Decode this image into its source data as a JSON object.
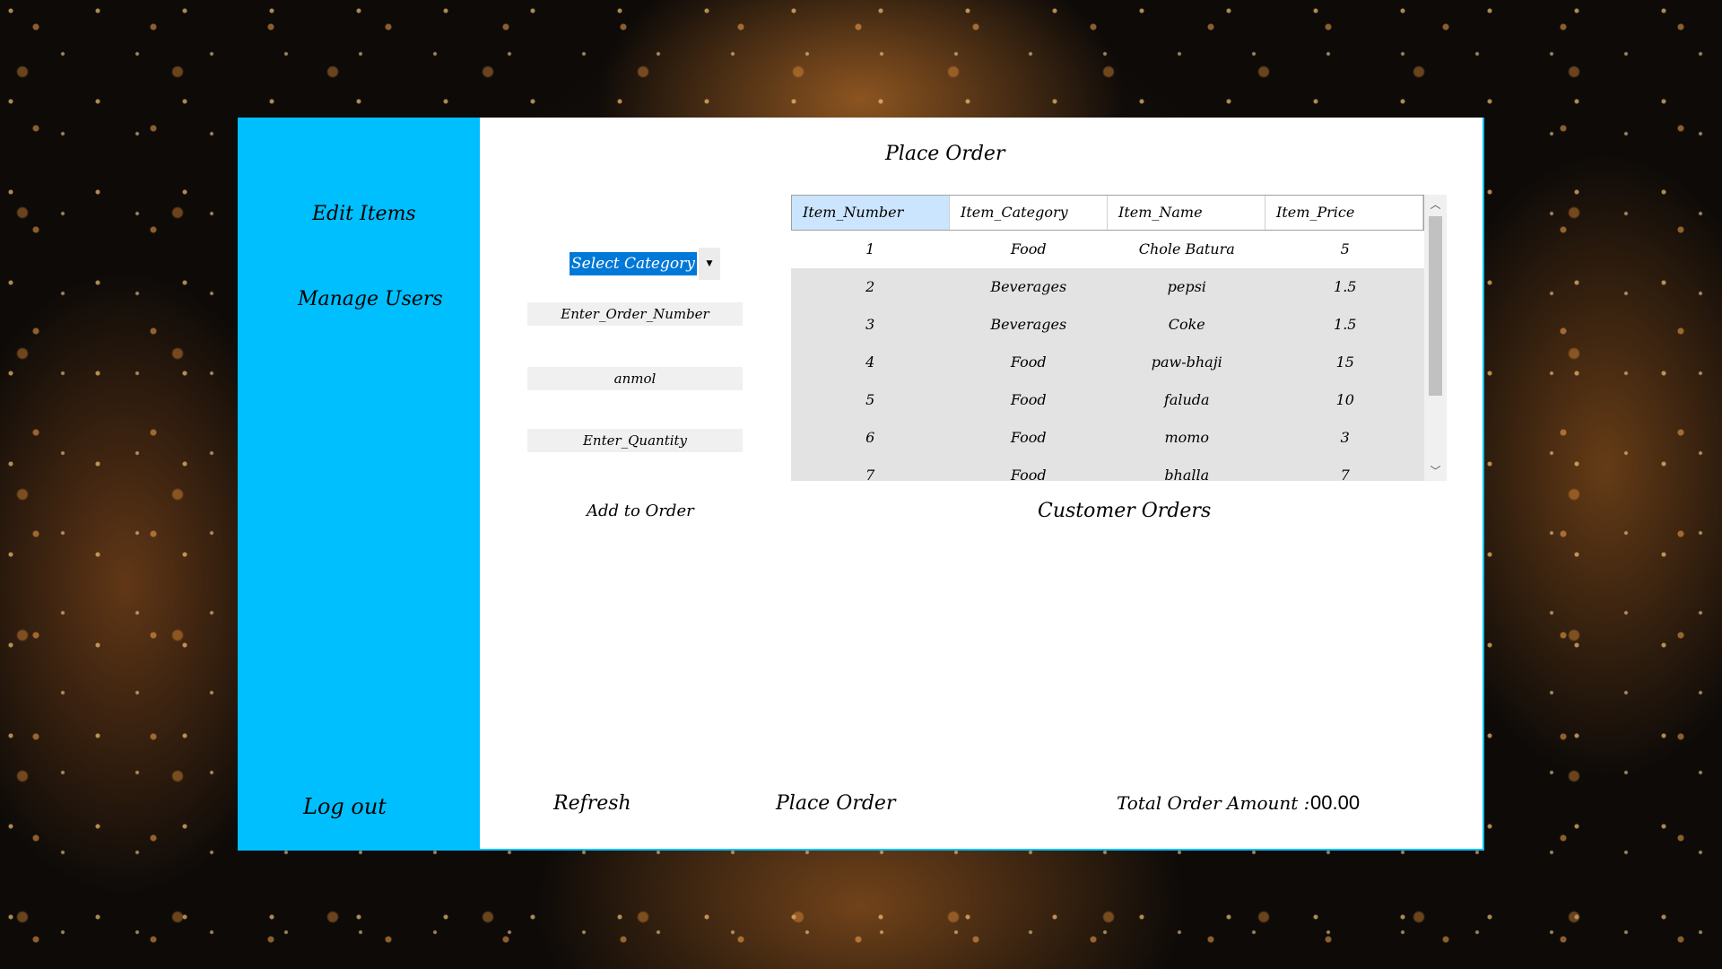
{
  "sidebar": {
    "items": [
      {
        "label": "Edit Items"
      },
      {
        "label": "Manage Users"
      }
    ],
    "logout_label": "Log out"
  },
  "main": {
    "title": "Place Order",
    "category_select": {
      "selected": "Select Category"
    },
    "order_number_field": {
      "value": "Enter_Order_Number"
    },
    "customer_field": {
      "value": "anmol"
    },
    "quantity_field": {
      "value": "Enter_Quantity"
    },
    "add_button_label": "Add to Order",
    "items_grid": {
      "columns": [
        "Item_Number",
        "Item_Category",
        "Item_Name",
        "Item_Price"
      ],
      "rows": [
        [
          "1",
          "Food",
          "Chole Batura",
          "5"
        ],
        [
          "2",
          "Beverages",
          "pepsi",
          "1.5"
        ],
        [
          "3",
          "Beverages",
          "Coke",
          "1.5"
        ],
        [
          "4",
          "Food",
          "paw-bhaji",
          "15"
        ],
        [
          "5",
          "Food",
          "faluda",
          "10"
        ],
        [
          "6",
          "Food",
          "momo",
          "3"
        ],
        [
          "7",
          "Food",
          "bhalla",
          "7"
        ]
      ]
    },
    "orders_section_title": "Customer Orders",
    "refresh_label": "Refresh",
    "place_order_label": "Place Order",
    "total_label": "Total Order Amount :",
    "total_value": "00.00"
  },
  "colors": {
    "sidebar": "#00bfff",
    "selection": "#0078d7"
  }
}
